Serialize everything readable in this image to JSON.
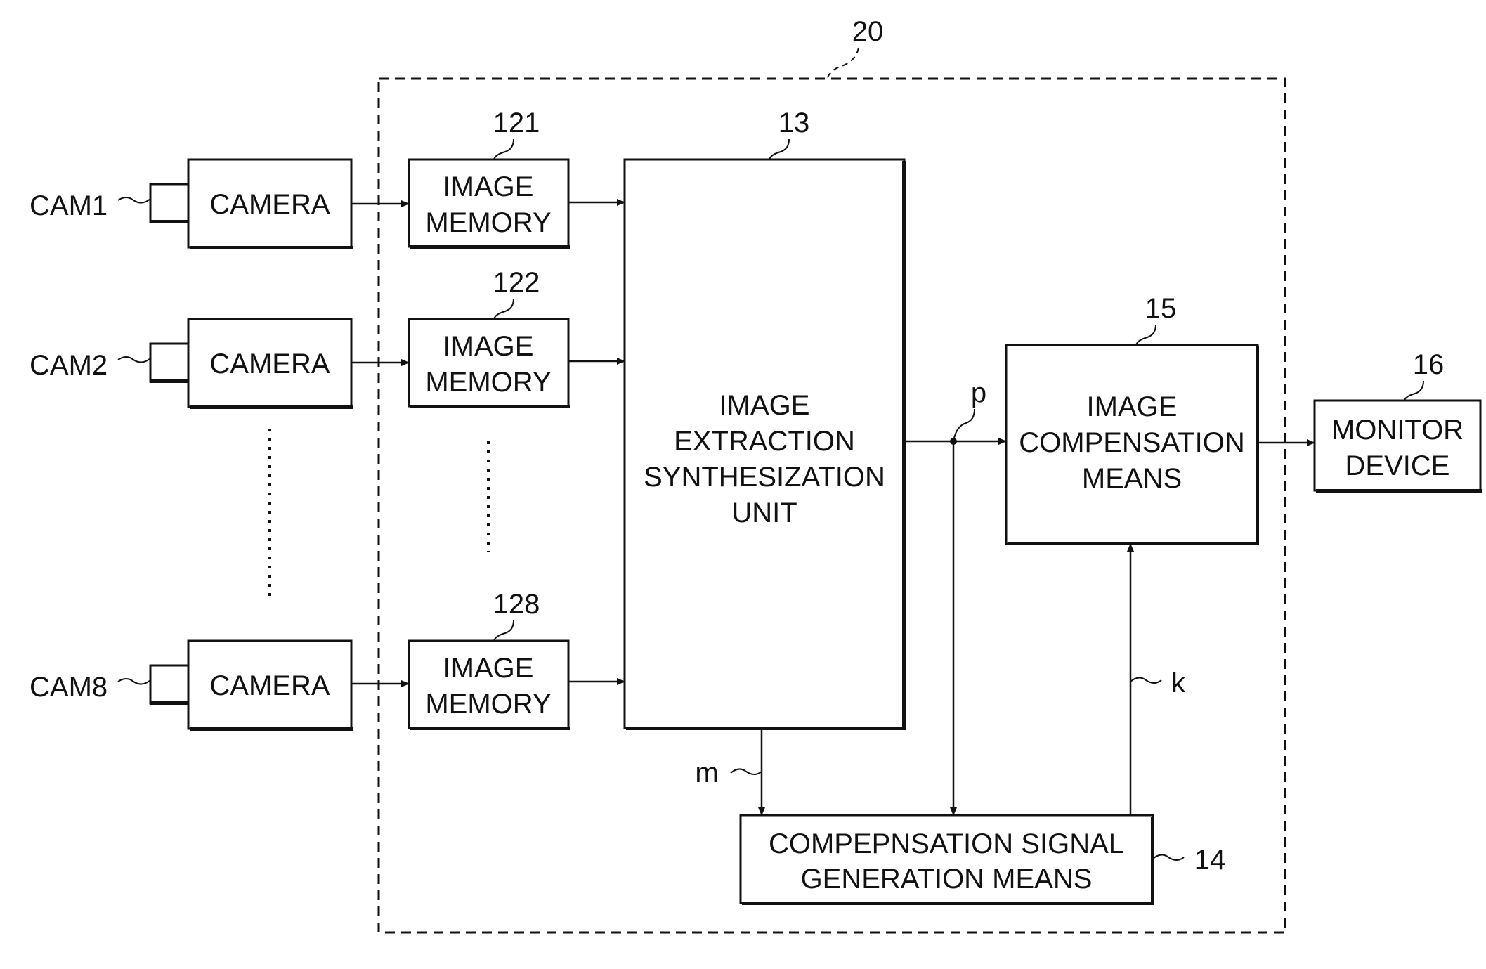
{
  "diagram": {
    "enclosure": {
      "ref": "20"
    },
    "cameras": [
      {
        "id": "CAM1",
        "label": "CAMERA"
      },
      {
        "id": "CAM2",
        "label": "CAMERA"
      },
      {
        "id": "CAM8",
        "label": "CAMERA"
      }
    ],
    "image_memories": [
      {
        "ref": "121",
        "line1": "IMAGE",
        "line2": "MEMORY"
      },
      {
        "ref": "122",
        "line1": "IMAGE",
        "line2": "MEMORY"
      },
      {
        "ref": "128",
        "line1": "IMAGE",
        "line2": "MEMORY"
      }
    ],
    "extraction_unit": {
      "ref": "13",
      "lines": [
        "IMAGE",
        "EXTRACTION",
        "SYNTHESIZATION",
        "UNIT"
      ]
    },
    "compensation_means": {
      "ref": "15",
      "lines": [
        "IMAGE",
        "COMPENSATION",
        "MEANS"
      ]
    },
    "monitor": {
      "ref": "16",
      "lines": [
        "MONITOR",
        "DEVICE"
      ]
    },
    "signal_generation": {
      "ref": "14",
      "lines": [
        "COMPEPNSATION SIGNAL",
        "GENERATION MEANS"
      ]
    },
    "signals": {
      "p": "p",
      "m": "m",
      "k": "k"
    }
  }
}
